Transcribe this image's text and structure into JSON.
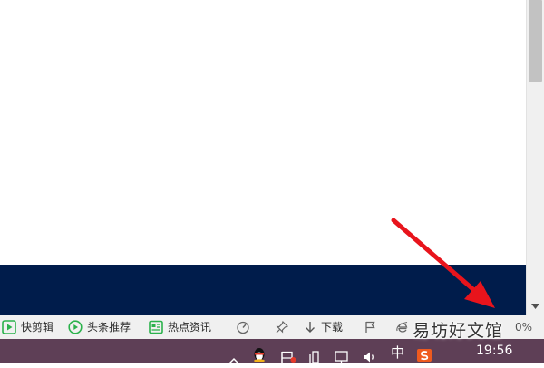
{
  "statusbar": {
    "items": [
      {
        "label": "快剪辑",
        "icon": "play-icon",
        "color": "#2bb24c"
      },
      {
        "label": "头条推荐",
        "icon": "circle-play-icon",
        "color": "#2bb24c"
      },
      {
        "label": "热点资讯",
        "icon": "news-icon",
        "color": "#2bb24c"
      },
      {
        "label": "",
        "icon": "speed-icon"
      },
      {
        "label": "",
        "icon": "pin-icon"
      },
      {
        "label": "下载",
        "icon": "download-icon"
      },
      {
        "label": "",
        "icon": "flag-icon"
      },
      {
        "label": "",
        "icon": "ie-icon"
      }
    ],
    "zoom": "0%"
  },
  "taskbar": {
    "ime_label": "中",
    "clock": "19:56",
    "tray_icons": [
      "chevron-up-icon",
      "qq-icon",
      "shield-flag-icon",
      "usb-icon",
      "network-icon",
      "volume-icon",
      "ime-icon",
      "sogou-icon"
    ]
  },
  "watermark": "易坊好文馆",
  "colors": {
    "dark_band": "#001c4b",
    "taskbar": "#5e3f56",
    "arrow": "#e8141c",
    "accent_green": "#2bb24c"
  }
}
